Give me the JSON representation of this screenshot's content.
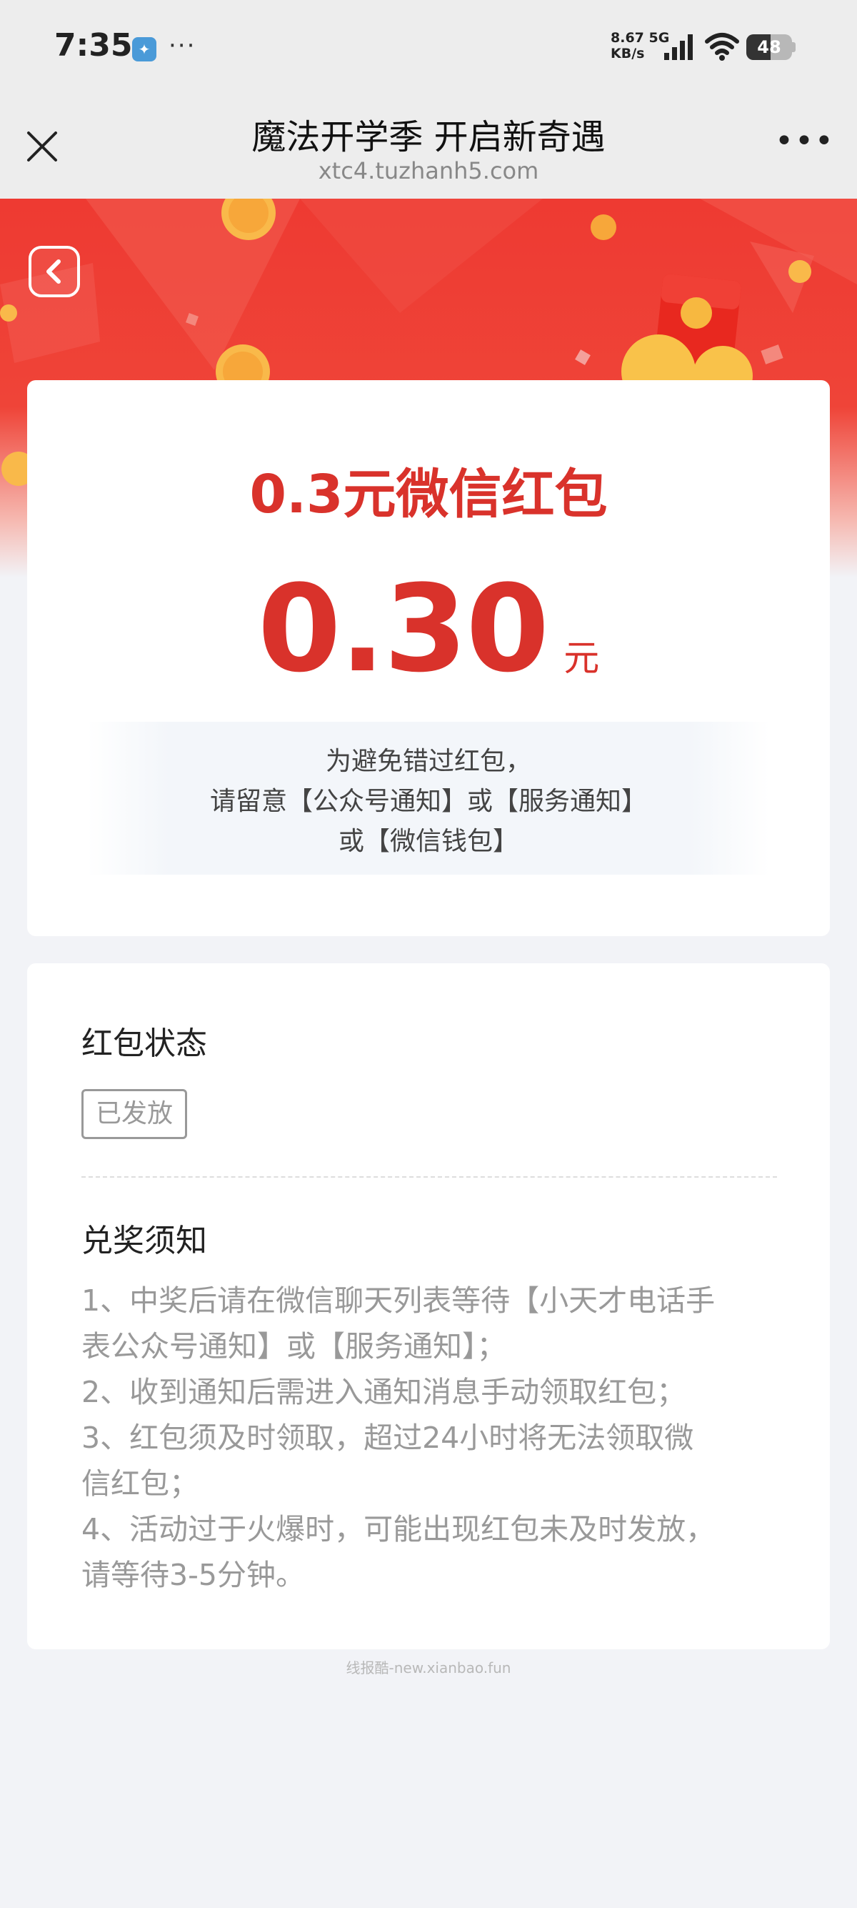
{
  "status_bar": {
    "time": "7:35",
    "notif_app_icon": "app-notification-icon",
    "more": "···",
    "net_speed_line1": "8.67 5G",
    "net_speed_line2": "KB/s",
    "battery": "48"
  },
  "nav": {
    "title": "魔法开学季 开启新奇遇",
    "url": "xtc4.tuzhanh5.com",
    "more": "•••"
  },
  "prize_card": {
    "title": "0.3元微信红包",
    "amount": "0.30",
    "unit": "元",
    "notice": [
      "为避免错过红包，",
      "请留意【公众号通知】或【服务通知】",
      "或【微信钱包】"
    ]
  },
  "info_card": {
    "status_title": "红包状态",
    "status_value": "已发放",
    "rules_title": "兑奖须知",
    "rules": [
      "1、中奖后请在微信聊天列表等待【小天才电话手",
      "表公众号通知】或【服务通知】；",
      "2、收到通知后需进入通知消息手动领取红包；",
      "3、红包须及时领取，超过24小时将无法领取微",
      "信红包；",
      "4、活动过于火爆时，可能出现红包未及时发放，",
      "请等待3-5分钟。"
    ]
  },
  "watermark": "线报酷-new.xianbao.fun",
  "colors": {
    "brand_red": "#d9322b",
    "banner_red": "#ee3a32"
  }
}
